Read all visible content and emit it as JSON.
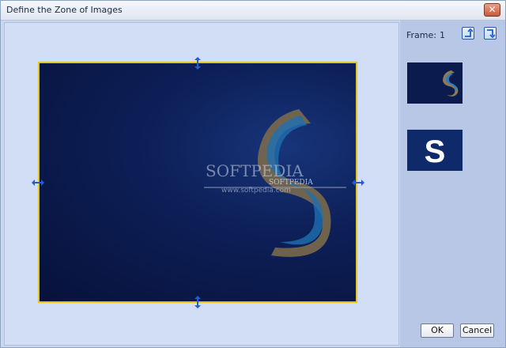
{
  "window": {
    "title": "Define the Zone of Images",
    "close_label": "✕"
  },
  "sidebar": {
    "frame_label": "Frame:",
    "frame_value": "1",
    "ok_label": "OK",
    "cancel_label": "Cancel"
  },
  "zone": {
    "border_color": "#e2c619",
    "watermark_main": "SOFTPEDIA",
    "watermark_sub": "www.softpedia.com",
    "watermark_small": "SOFTPEDIA"
  },
  "thumbnails": [
    {
      "name": "island-thumbnail"
    },
    {
      "name": "s-logo-thumbnail",
      "glyph": "S"
    }
  ],
  "colors": {
    "accent": "#1e5fd6",
    "zone_border": "#e2c619",
    "sidebar_bg": "#b7c7e5",
    "canvas_bg": "#d2def6"
  }
}
